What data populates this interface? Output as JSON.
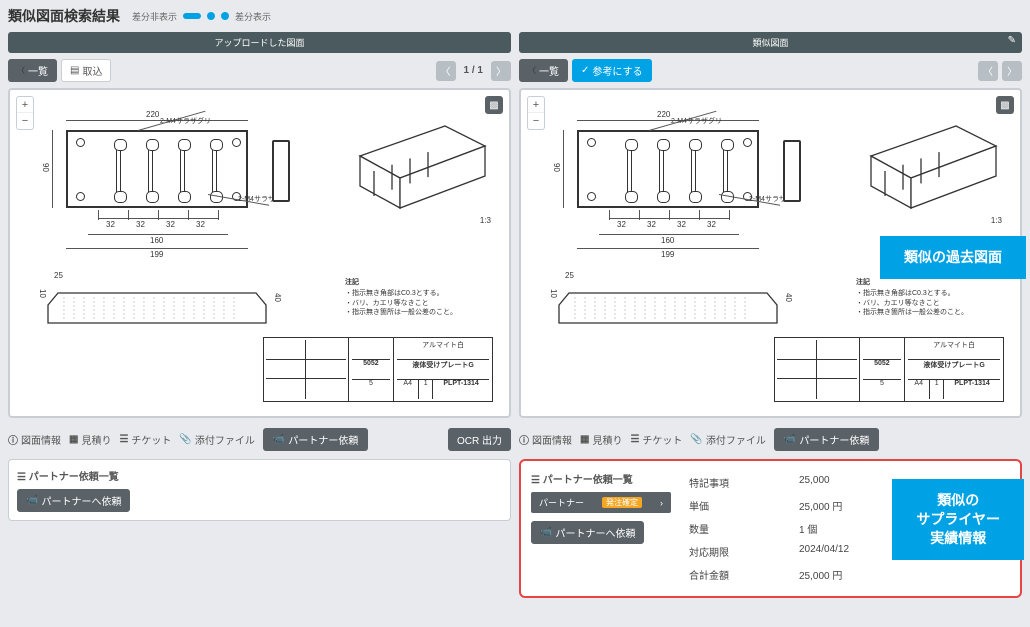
{
  "header": {
    "title": "類似図面検索結果",
    "diff_hide": "差分非表示",
    "diff_show": "差分表示"
  },
  "panels": {
    "left": {
      "head": "アップロードした図面",
      "back": "一覧",
      "include": "取込",
      "pager": "1 / 1"
    },
    "right": {
      "head": "類似図面",
      "back": "一覧",
      "reference": "参考にする",
      "edit_icon": "✎"
    }
  },
  "drawing": {
    "dims": {
      "top": "220",
      "side": "90",
      "bottom_seg": "32",
      "bottom_mid": "160",
      "bottom_full": "199",
      "scale": "1:3",
      "prof_w": "25",
      "prof_h1": "10",
      "prof_h2": "40"
    },
    "callouts": {
      "upper": "2-M4サラザグリ",
      "lower": "2-M4サラザグリ"
    },
    "notes": {
      "hd": "注記",
      "l1": "・指示無き角部はC0.3とする。",
      "l2": "・バリ、カエリ等なきこと",
      "l3": "・指示無き箇所は一般公差のこと。"
    },
    "title_block": {
      "material_label": "アルマイト白",
      "part_name": "液体受けプレートG",
      "mat": "5052",
      "qty": "5",
      "size": "A4",
      "sheet": "1",
      "part_no": "PLPT-1314"
    }
  },
  "tabs": {
    "info": "図面情報",
    "estimate": "見積り",
    "ticket": "チケット",
    "attach": "添付ファイル",
    "partner": "パートナー依頼",
    "ocr": "OCR 出力"
  },
  "partner_left": {
    "title": "パートナー依頼一覧",
    "send": "パートナーへ依頼"
  },
  "partner_right": {
    "title": "パートナー依頼一覧",
    "select_label": "パートナー",
    "select_badge": "発注確定",
    "send": "パートナーへ依頼",
    "rows": {
      "remark_k": "特記事項",
      "remark_v": "25,000",
      "unit_k": "単価",
      "unit_v": "25,000 円",
      "qty_k": "数量",
      "qty_v": "1 個",
      "due_k": "対応期限",
      "due_v": "2024/04/12",
      "total_k": "合計金額",
      "total_v": "25,000 円"
    }
  },
  "callouts": {
    "past": "類似の過去図面",
    "supplier_l1": "類似の",
    "supplier_l2": "サプライヤー",
    "supplier_l3": "実績情報"
  }
}
